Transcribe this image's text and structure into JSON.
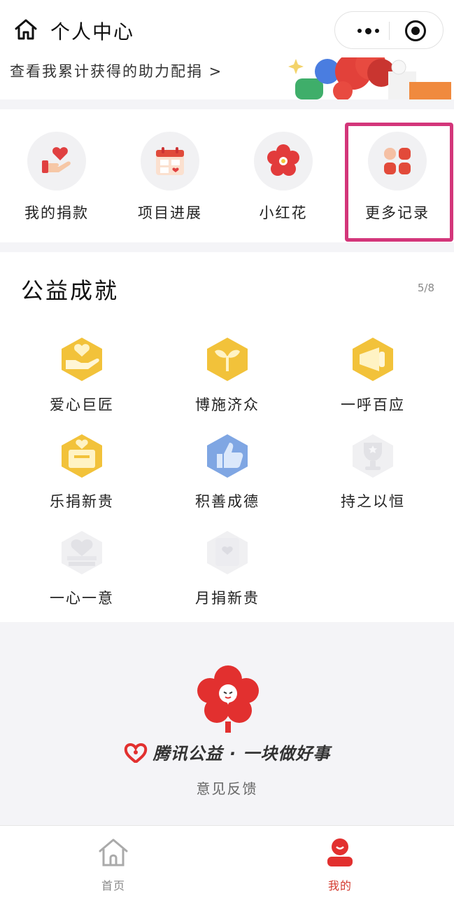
{
  "header": {
    "title": "个人中心",
    "home_icon": "home-icon",
    "capsule": {
      "more_icon": "more-dots-icon",
      "close_icon": "target-close-icon"
    }
  },
  "banner": {
    "link_text": "查看我累计获得的助力配捐 >"
  },
  "quick_entries": [
    {
      "label": "我的捐款",
      "icon": "donation-heart-hand-icon"
    },
    {
      "label": "项目进展",
      "icon": "calendar-icon"
    },
    {
      "label": "小红花",
      "icon": "red-flower-icon"
    },
    {
      "label": "更多记录",
      "icon": "grid-more-icon"
    }
  ],
  "achievements": {
    "title": "公益成就",
    "count": "5/8",
    "items": [
      {
        "name": "爱心巨匠",
        "icon": "gold-heart-hand-badge-icon",
        "unlocked": true
      },
      {
        "name": "博施济众",
        "icon": "gold-sprout-badge-icon",
        "unlocked": true
      },
      {
        "name": "一呼百应",
        "icon": "gold-megaphone-badge-icon",
        "unlocked": true
      },
      {
        "name": "乐捐新贵",
        "icon": "gold-box-heart-badge-icon",
        "unlocked": true
      },
      {
        "name": "积善成德",
        "icon": "blue-thumbs-up-badge-icon",
        "unlocked": true
      },
      {
        "name": "持之以恒",
        "icon": "grey-trophy-badge-icon",
        "unlocked": false
      },
      {
        "name": "一心一意",
        "icon": "grey-heart-stack-badge-icon",
        "unlocked": false
      },
      {
        "name": "月捐新贵",
        "icon": "grey-heart-card-badge-icon",
        "unlocked": false
      }
    ]
  },
  "brand": {
    "slogan": "腾讯公益 · 一块做好事",
    "feedback": "意见反馈"
  },
  "tabbar": [
    {
      "label": "首页",
      "icon": "home-tab-icon",
      "active": false
    },
    {
      "label": "我的",
      "icon": "profile-tab-icon",
      "active": true
    }
  ],
  "colors": {
    "accent": "#d43b2f",
    "highlight_border": "#d3367a",
    "gold": "#f2c23a"
  }
}
